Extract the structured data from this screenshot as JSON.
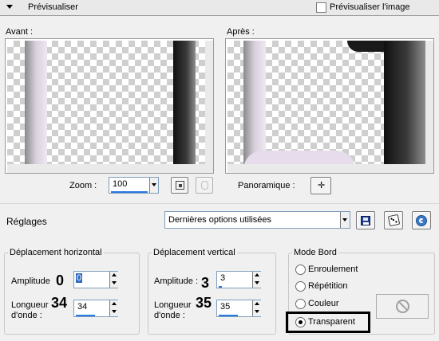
{
  "preview": {
    "title": "Prévisualiser",
    "preview_image_label": "Prévisualiser l'image",
    "before_label": "Avant :",
    "after_label": "Après :",
    "zoom_label": "Zoom :",
    "zoom_value": "100",
    "pan_label": "Panoramique :"
  },
  "settings": {
    "label": "Réglages",
    "preset_value": "Dernières options utilisées"
  },
  "horizontal": {
    "title": "Déplacement horizontal",
    "amplitude_label": "Amplitude",
    "amplitude_value": "0",
    "amplitude_big": "0",
    "wavelength_label_1": "Longueur",
    "wavelength_label_2": "d'onde :",
    "wavelength_value": "34",
    "wavelength_big": "34"
  },
  "vertical": {
    "title": "Déplacement vertical",
    "amplitude_label": "Amplitude :",
    "amplitude_value": "3",
    "amplitude_big": "3",
    "wavelength_label_1": "Longueur",
    "wavelength_label_2": "d'onde :",
    "wavelength_value": "35",
    "wavelength_big": "35"
  },
  "edge_mode": {
    "title": "Mode Bord",
    "options": [
      "Enroulement",
      "Répétition",
      "Couleur",
      "Transparent"
    ],
    "selected": "Transparent"
  },
  "colors": {
    "accent": "#2a7ae2",
    "highlight_box": "#000000"
  }
}
